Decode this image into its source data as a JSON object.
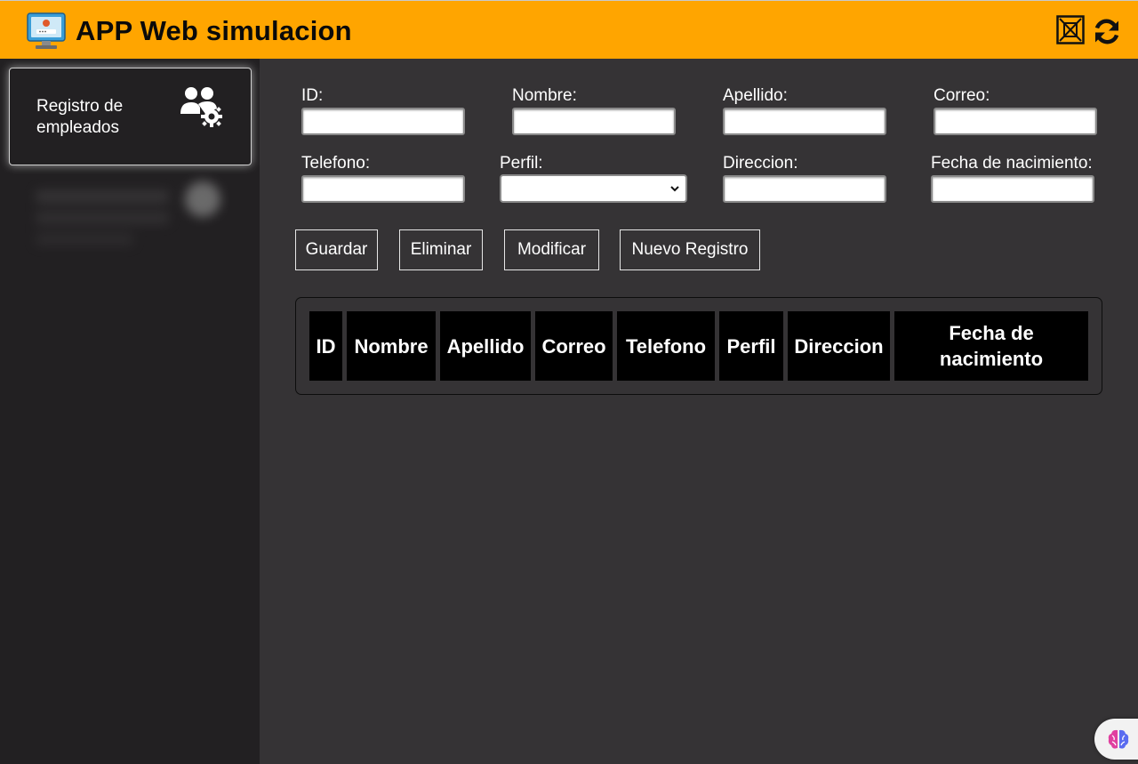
{
  "header": {
    "title": "APP Web simulacion",
    "logo_icon": "monitor-login-icon",
    "close_icon": "close-window-icon",
    "refresh_icon": "refresh-icon",
    "bg_color": "#ffa500"
  },
  "sidebar": {
    "items": [
      {
        "label": "Registro de empleados",
        "icon": "users-gear-icon",
        "active": true
      }
    ]
  },
  "form": {
    "fields": [
      {
        "label": "ID:",
        "value": ""
      },
      {
        "label": "Nombre:",
        "value": ""
      },
      {
        "label": "Apellido:",
        "value": ""
      },
      {
        "label": "Correo:",
        "value": ""
      },
      {
        "label": "Telefono:",
        "value": ""
      },
      {
        "label": "Perfil:",
        "value": ""
      },
      {
        "label": "Direccion:",
        "value": ""
      },
      {
        "label": "Fecha de nacimiento:",
        "value": ""
      }
    ],
    "buttons": {
      "save": "Guardar",
      "delete": "Eliminar",
      "modify": "Modificar",
      "new": "Nuevo Registro"
    }
  },
  "table": {
    "columns": [
      "ID",
      "Nombre",
      "Apellido",
      "Correo",
      "Telefono",
      "Perfil",
      "Direccion",
      "Fecha de nacimiento"
    ],
    "rows": []
  }
}
